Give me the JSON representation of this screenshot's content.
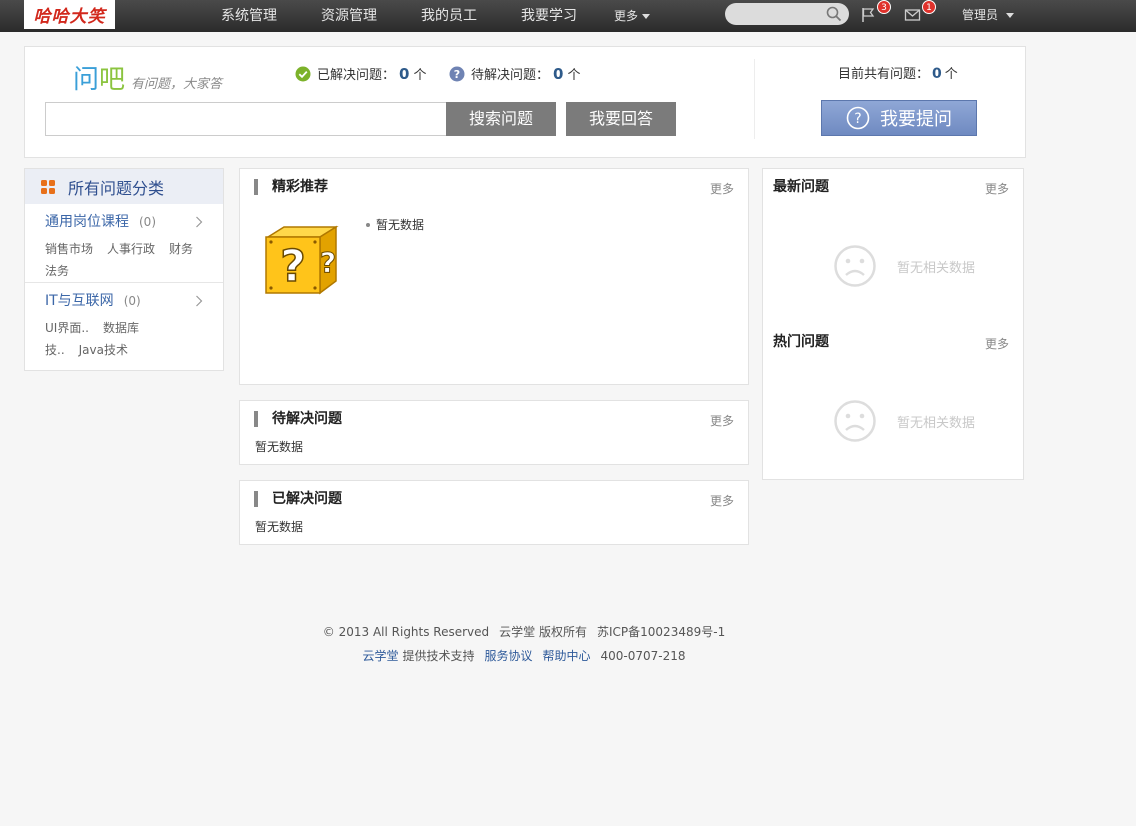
{
  "logo": {
    "text": "哈哈大笑"
  },
  "nav": {
    "items": [
      "系统管理",
      "资源管理",
      "我的员工",
      "我要学习"
    ],
    "more_label": "更多"
  },
  "topbar": {
    "search_placeholder": "",
    "flag_count": "3",
    "mail_count": "1",
    "user_label": "管理员"
  },
  "header": {
    "brand_title_a": "问",
    "brand_title_b": "吧",
    "brand_slogan": "有问题，大家答",
    "solved_label": "已解决问题：",
    "solved_count": "0",
    "solved_unit": "个",
    "pending_label": "待解决问题：",
    "pending_count": "0",
    "pending_unit": "个",
    "search_placeholder": "",
    "search_button": "搜索问题",
    "answer_button": "我要回答",
    "total_label": "目前共有问题：",
    "total_count": "0",
    "total_unit": "个",
    "ask_button": "我要提问"
  },
  "sidebar": {
    "title": "所有问题分类",
    "categories": [
      {
        "name": "通用岗位课程",
        "count": "(0)",
        "subs": [
          "销售市场",
          "人事行政",
          "财务法务"
        ]
      },
      {
        "name": "IT与互联网",
        "count": "(0)",
        "subs": [
          "UI界面..",
          "数据库技..",
          "Java技术"
        ]
      }
    ]
  },
  "featured": {
    "title": "精彩推荐",
    "more": "更多",
    "empty": "暂无数据"
  },
  "pending": {
    "title": "待解决问题",
    "more": "更多",
    "empty": "暂无数据"
  },
  "solved": {
    "title": "已解决问题",
    "more": "更多",
    "empty": "暂无数据"
  },
  "latest": {
    "title": "最新问题",
    "more": "更多",
    "empty": "暂无相关数据"
  },
  "hot": {
    "title": "热门问题",
    "more": "更多",
    "empty": "暂无相关数据"
  },
  "footer": {
    "copyright": "© 2013 All Rights Reserved",
    "company": "云学堂 版权所有",
    "icp": "苏ICP备10023489号-1",
    "tech_link": "云学堂",
    "tech_suffix": "提供技术支持",
    "agreement": "服务协议",
    "help": "帮助中心",
    "phone": "400-0707-218"
  },
  "colors": {
    "accent": "#2e5a8a",
    "topbar": "#333333",
    "ask_button": "#7f98cc",
    "badge": "#e0322c"
  }
}
